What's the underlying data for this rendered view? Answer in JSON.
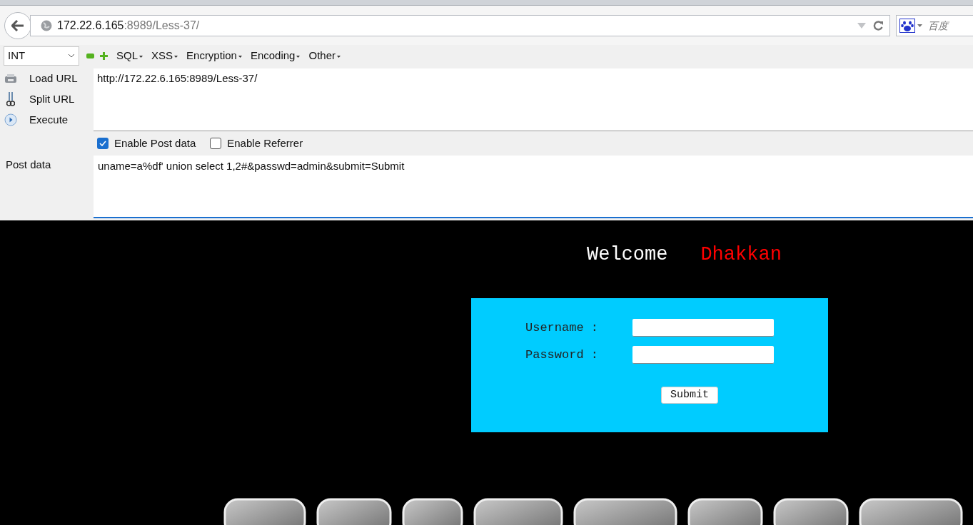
{
  "browser": {
    "address": {
      "host": "172.22.6.165",
      "rest": ":8989/Less-37/"
    },
    "search_placeholder": "百度"
  },
  "hackbar": {
    "type_select": "INT",
    "menus": [
      "SQL",
      "XSS",
      "Encryption",
      "Encoding",
      "Other"
    ],
    "actions": [
      {
        "label": "Load URL",
        "kind": "load"
      },
      {
        "label": "Split URL",
        "kind": "split"
      },
      {
        "label": "Execute",
        "kind": "execute"
      }
    ],
    "url": "http://172.22.6.165:8989/Less-37/",
    "options": [
      {
        "label": "Enable Post data",
        "checked": true
      },
      {
        "label": "Enable Referrer",
        "checked": false
      }
    ],
    "post_label": "Post data",
    "post_data": "uname=a%df' union select 1,2#&passwd=admin&submit=Submit"
  },
  "page": {
    "welcome": "Welcome",
    "user": "Dhakkan",
    "fields": [
      {
        "label": "Username :"
      },
      {
        "label": "Password :"
      }
    ],
    "submit": "Submit"
  }
}
